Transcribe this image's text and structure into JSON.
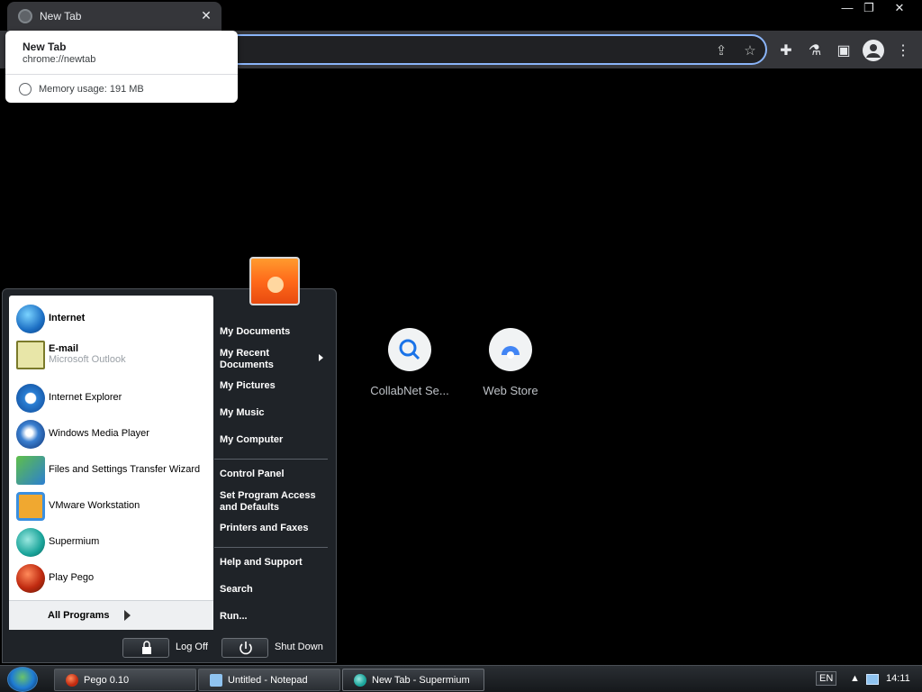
{
  "browser": {
    "tab_title": "New Tab",
    "close_glyph": "✕",
    "window_controls": [
      "—",
      "❐",
      "✕"
    ],
    "toolbar_icons": [
      "extensions-icon",
      "labs-icon",
      "sidepanel-icon",
      "profile-icon",
      "menu-icon"
    ],
    "omnibox_icons": [
      "share-icon",
      "star-icon"
    ]
  },
  "hovercard": {
    "title": "New Tab",
    "url": "chrome://newtab",
    "memory": "Memory usage: 191 MB"
  },
  "shortcuts": [
    {
      "label": "CollabNet Se...",
      "icon": "search-icon"
    },
    {
      "label": "Web Store",
      "icon": "webstore-icon"
    }
  ],
  "startmenu": {
    "programs": [
      {
        "name": "Internet",
        "sub": "",
        "bold": true
      },
      {
        "name": "E-mail",
        "sub": "Microsoft Outlook",
        "bold": true
      },
      {
        "name": "Internet Explorer",
        "sub": ""
      },
      {
        "name": "Windows Media Player",
        "sub": ""
      },
      {
        "name": "Files and Settings Transfer Wizard",
        "sub": ""
      },
      {
        "name": "VMware Workstation",
        "sub": ""
      },
      {
        "name": "Supermium",
        "sub": ""
      },
      {
        "name": "Play Pego",
        "sub": ""
      }
    ],
    "all_programs": "All Programs",
    "right_items": [
      "My Documents",
      "My Recent Documents",
      "My Pictures",
      "My Music",
      "My Computer",
      "Control Panel",
      "Set Program Access and Defaults",
      "Printers and Faxes",
      "Help and Support",
      "Search",
      "Run..."
    ],
    "log_off": "Log Off",
    "shut_down": "Shut Down"
  },
  "taskbar": {
    "buttons": [
      {
        "label": "Pego 0.10"
      },
      {
        "label": "Untitled - Notepad"
      },
      {
        "label": "New Tab - Supermium"
      }
    ],
    "language": "EN",
    "clock": "14:11"
  }
}
